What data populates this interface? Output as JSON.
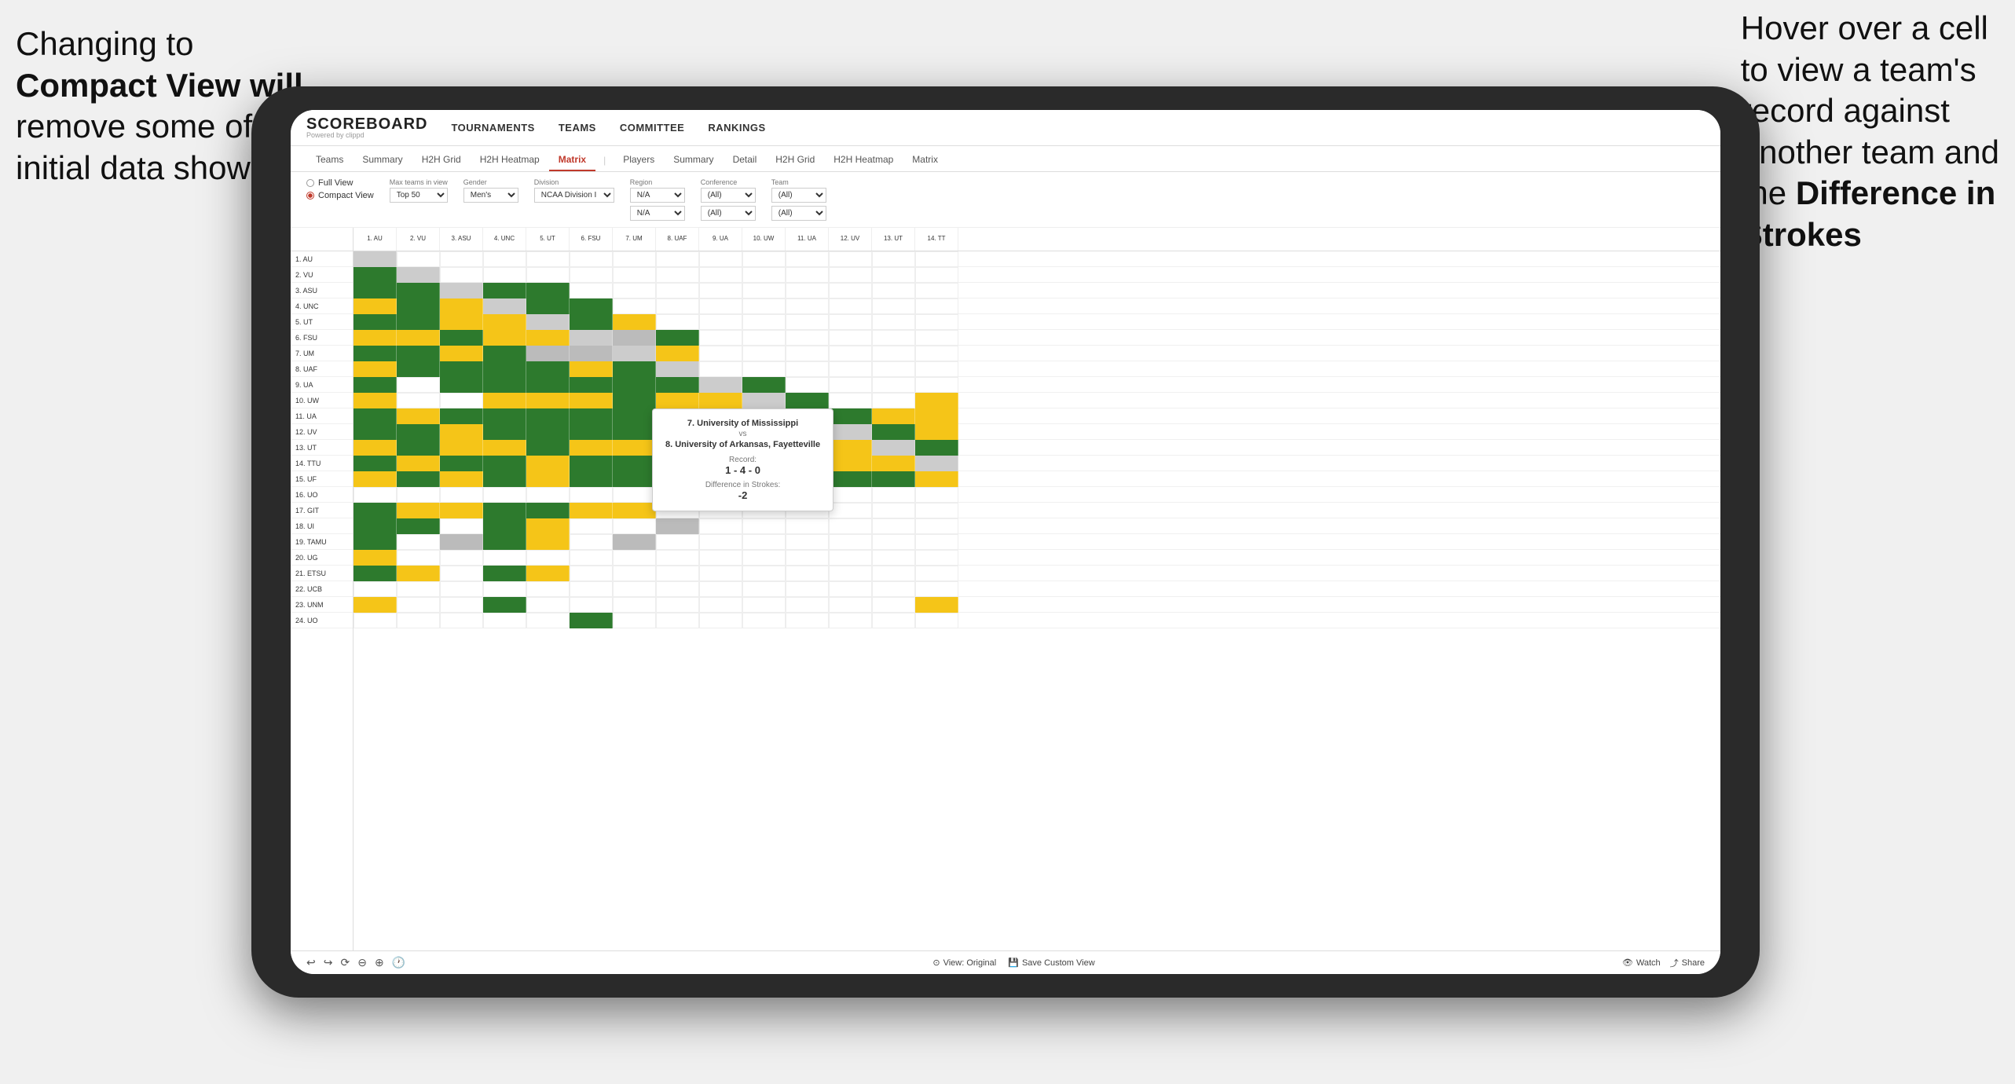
{
  "annotation_left": {
    "line1": "Changing to",
    "line2": "Compact View will",
    "line3": "remove some of the",
    "line4": "initial data shown"
  },
  "annotation_right": {
    "line1": "Hover over a cell",
    "line2": "to view a team's",
    "line3": "record against",
    "line4": "another team and",
    "line5": "the ",
    "line5_bold": "Difference in",
    "line6": "Strokes"
  },
  "nav": {
    "logo": "SCOREBOARD",
    "logo_sub": "Powered by clippd",
    "links": [
      "TOURNAMENTS",
      "TEAMS",
      "COMMITTEE",
      "RANKINGS"
    ]
  },
  "sub_tabs": {
    "group1": [
      "Teams",
      "Summary",
      "H2H Grid",
      "H2H Heatmap",
      "Matrix"
    ],
    "group2": [
      "Players",
      "Summary",
      "Detail",
      "H2H Grid",
      "H2H Heatmap",
      "Matrix"
    ],
    "active": "Matrix"
  },
  "controls": {
    "view_full": "Full View",
    "view_compact": "Compact View",
    "max_teams_label": "Max teams in view",
    "max_teams_value": "Top 50",
    "gender_label": "Gender",
    "gender_value": "Men's",
    "division_label": "Division",
    "division_value": "NCAA Division I",
    "region_label": "Region",
    "region_value": "N/A",
    "conference_label": "Conference",
    "conference_value": "(All)",
    "team_label": "Team",
    "team_value": "(All)"
  },
  "col_headers": [
    "1. AU",
    "2. VU",
    "3. ASU",
    "4. UNC",
    "5. UT",
    "6. FSU",
    "7. UM",
    "8. UAF",
    "9. UA",
    "10. UW",
    "11. UA",
    "12. UV",
    "13. UT",
    "14. TT"
  ],
  "row_labels": [
    "1. AU",
    "2. VU",
    "3. ASU",
    "4. UNC",
    "5. UT",
    "6. FSU",
    "7. UM",
    "8. UAF",
    "9. UA",
    "10. UW",
    "11. UA",
    "12. UV",
    "13. UT",
    "14. TTU",
    "15. UF",
    "16. UO",
    "17. GIT",
    "18. UI",
    "19. TAMU",
    "20. UG",
    "21. ETSU",
    "22. UCB",
    "23. UNM",
    "24. UO"
  ],
  "tooltip": {
    "team1": "7. University of Mississippi",
    "vs": "vs",
    "team2": "8. University of Arkansas, Fayetteville",
    "record_label": "Record:",
    "record_value": "1 - 4 - 0",
    "strokes_label": "Difference in Strokes:",
    "strokes_value": "-2"
  },
  "bottom_toolbar": {
    "view_original": "View: Original",
    "save_custom": "Save Custom View",
    "watch": "Watch",
    "share": "Share"
  }
}
